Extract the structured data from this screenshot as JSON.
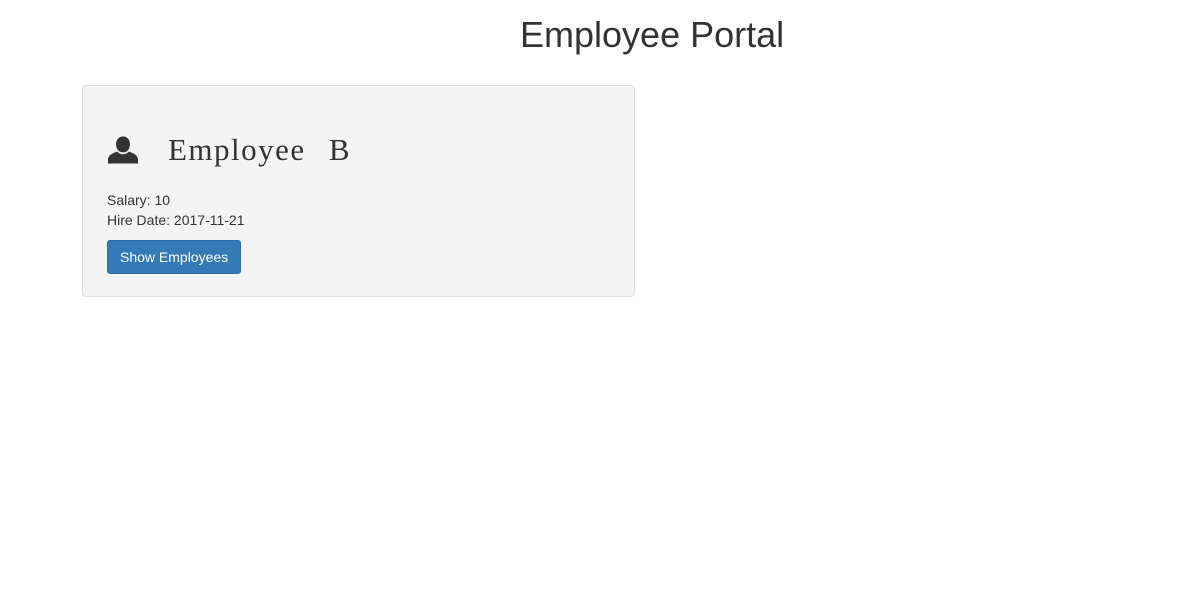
{
  "header": {
    "title": "Employee Portal"
  },
  "employee_card": {
    "avatar_icon": "user-icon",
    "name": "Employee B",
    "salary_label": "Salary:",
    "salary_value": "10",
    "hire_date_label": "Hire Date:",
    "hire_date_value": "2017-11-21",
    "button_label": "Show Employees"
  },
  "colors": {
    "button_background": "#337ab7",
    "card_background": "#f4f4f4",
    "text": "#333333"
  }
}
